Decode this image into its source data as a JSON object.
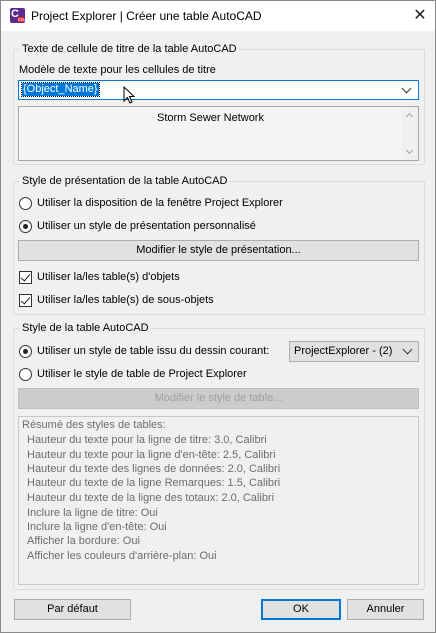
{
  "window": {
    "title": "Project Explorer | Créer une table AutoCAD"
  },
  "title_cell_group": {
    "label": "Texte de cellule de titre de la table AutoCAD",
    "template_label": "Modèle de texte pour les cellules de titre",
    "template_value": "{Object_Name}",
    "preview_text": "Storm Sewer Network"
  },
  "layout_group": {
    "label": "Style de présentation de la table AutoCAD",
    "option_window_layout": "Utiliser la disposition de la fenêtre Project Explorer",
    "option_custom_layout": "Utiliser un style de présentation personnalisé",
    "selected_option": "custom",
    "modify_layout_button": "Modifier le style de présentation...",
    "use_object_tables": "Utiliser la/les table(s) d'objets",
    "use_subobject_tables": "Utiliser la/les table(s) de sous-objets",
    "use_object_tables_checked": true,
    "use_subobject_tables_checked": true
  },
  "table_style_group": {
    "label": "Style de la table AutoCAD",
    "option_drawing_style": "Utiliser un style de table issu du dessin courant:",
    "option_pe_style": "Utiliser le style de table de Project Explorer",
    "selected_option": "drawing",
    "style_dropdown_value": "ProjectExplorer - (2)",
    "modify_table_style_button": "Modifier le style de table...",
    "summary": [
      "Résumé des styles de tables:",
      "  Hauteur du texte pour la ligne de titre: 3.0, Calibri",
      "  Hauteur du texte pour la ligne d'en-tête: 2.5, Calibri",
      "  Hauteur du texte des lignes de données: 2.0, Calibri",
      "  Hauteur du texte de la ligne Remarques: 1.5, Calibri",
      "  Hauteur du texte de la ligne des totaux: 2.0, Calibri",
      "  Inclure la ligne de titre: Oui",
      "  Inclure la ligne d'en-tête: Oui",
      "  Afficher la bordure: Oui",
      "  Afficher les couleurs d'arrière-plan: Oui"
    ]
  },
  "footer": {
    "default_button": "Par défaut",
    "ok_button": "OK",
    "cancel_button": "Annuler"
  },
  "colors": {
    "accent": "#0078d7",
    "app_icon": "#5b2a8f"
  }
}
